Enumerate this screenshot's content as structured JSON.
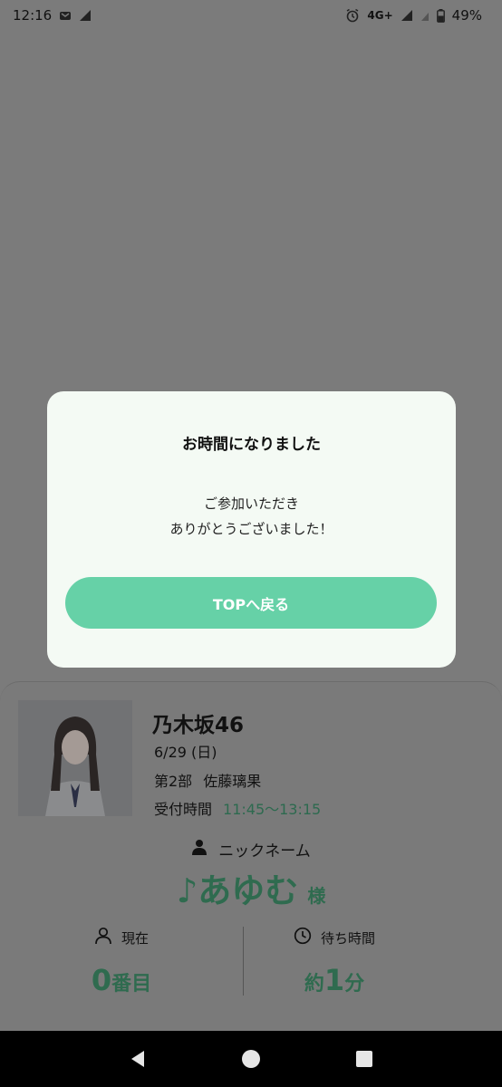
{
  "status_bar": {
    "time": "12:16",
    "network": "4G+",
    "battery": "49%"
  },
  "modal": {
    "title": "お時間になりました",
    "message_line1": "ご参加いただき",
    "message_line2": "ありがとうございました！",
    "button_label": "TOPへ戻る"
  },
  "event": {
    "group": "乃木坂46",
    "date": "6/29 (日)",
    "part": "第2部",
    "member": "佐藤璃果",
    "reception_label": "受付時間",
    "reception_time": "11:45〜13:15"
  },
  "nickname": {
    "label": "ニックネーム",
    "value": "♪あゆむ",
    "honorific": "様"
  },
  "stats": {
    "current_label": "現在",
    "current_num": "0",
    "current_unit": "番目",
    "wait_label": "待ち時間",
    "wait_prefix": "約",
    "wait_num": "1",
    "wait_unit": "分"
  },
  "colors": {
    "accent": "#66d1a7",
    "accent_dark": "#2f6b4f",
    "modal_bg": "#f4faf4",
    "overlay": "#7b7b7b"
  }
}
